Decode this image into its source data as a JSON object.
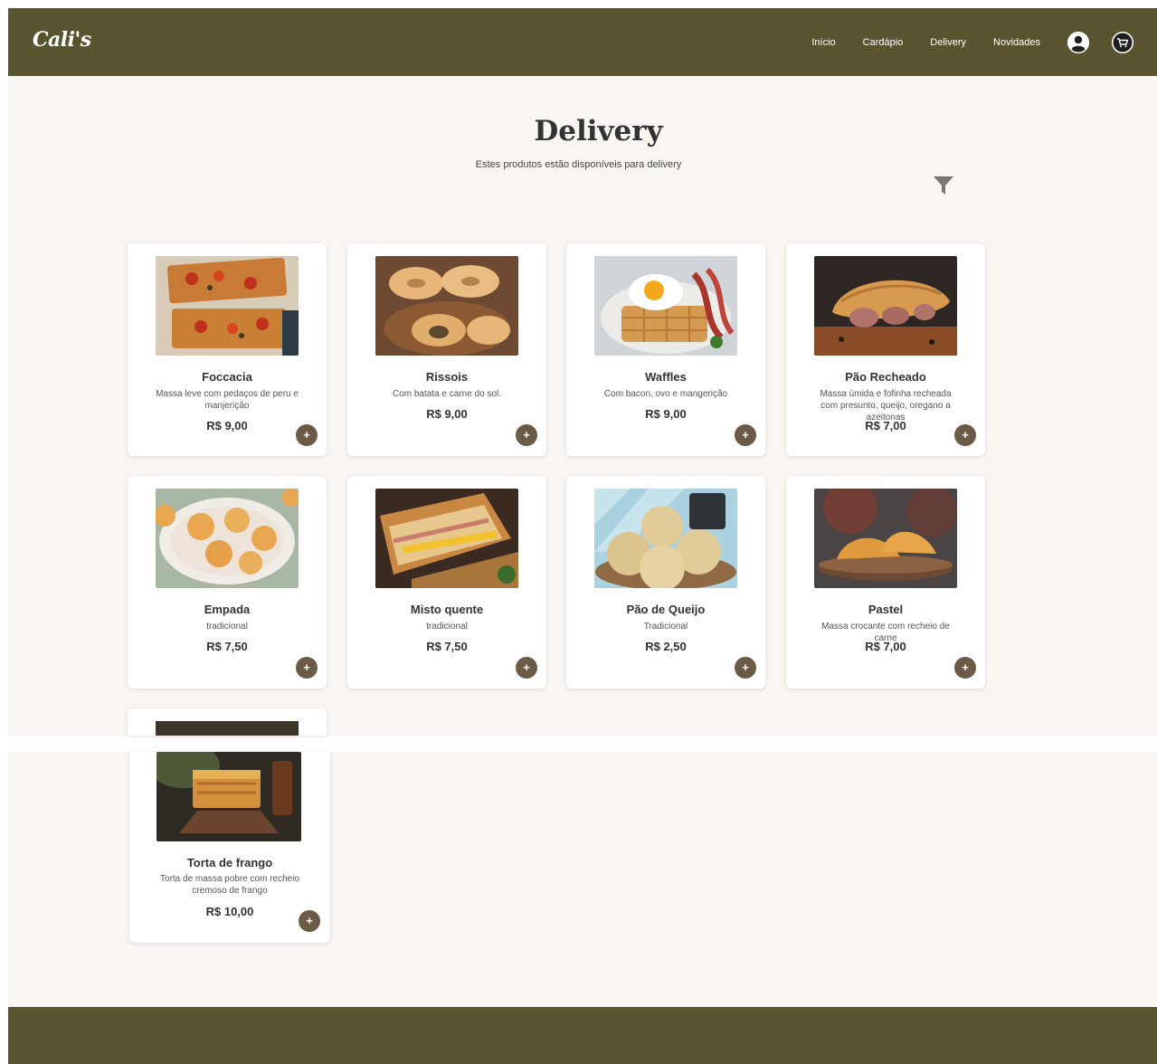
{
  "brand": {
    "logo": "Cali's"
  },
  "nav": {
    "links": [
      "Início",
      "Cardápio",
      "Delivery",
      "Novidades"
    ],
    "profile_icon": "user-icon",
    "cart_icon": "cart-icon"
  },
  "header": {
    "title": "Delivery",
    "subtitle": "Estes produtos estão disponíveis para delivery",
    "filter_icon": "filter-icon"
  },
  "products": [
    {
      "name": "Foccacia",
      "desc": "Massa leve com pedaços de peru e manjerição",
      "price": "R$ 9,00",
      "image": "foccacia-image"
    },
    {
      "name": "Rissois",
      "desc": "Com batata e carne do sol.",
      "price": "R$ 9,00",
      "image": "rissois-image"
    },
    {
      "name": "Waffles",
      "desc": "Com bacon, ovo e mangerição",
      "price": "R$ 9,00",
      "image": "waffles-image"
    },
    {
      "name": "Pão Recheado",
      "desc": "Massa úmida e fofinha recheada com presunto, queijo, oregano a azeitonas",
      "price": "R$ 7,00",
      "image": "pao-recheado-image"
    },
    {
      "name": "Empada",
      "desc": "tradicional",
      "price": "R$ 7,50",
      "image": "empada-image"
    },
    {
      "name": "Misto quente",
      "desc": "tradicional",
      "price": "R$ 7,50",
      "image": "misto-quente-image"
    },
    {
      "name": "Pão de Queijo",
      "desc": "Tradicional",
      "price": "R$ 2,50",
      "image": "pao-de-queijo-image"
    },
    {
      "name": "Pastel",
      "desc": "Massa crocante com recheio de carne",
      "price": "R$ 7,00",
      "image": "pastel-image"
    },
    {
      "name": "Torta de frango",
      "desc": "Torta de massa pobre com recheio cremoso de frango",
      "price": "R$ 10,00",
      "image": "torta-de-frango-image"
    }
  ],
  "add_button_label": "+",
  "colors": {
    "brand": "#585430",
    "background": "#f9f6f1",
    "add_button": "#6b5a45"
  }
}
